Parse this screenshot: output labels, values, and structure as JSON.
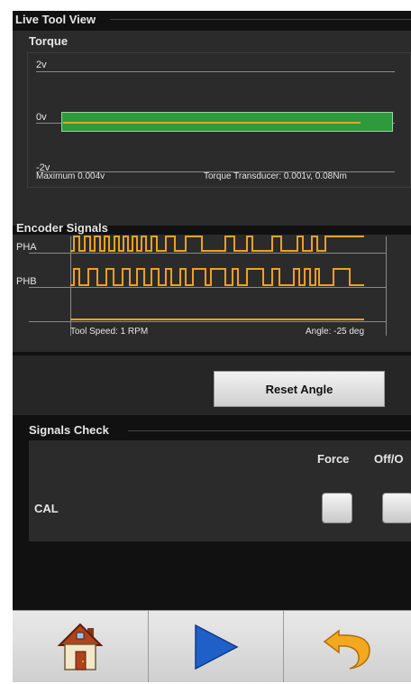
{
  "window": {
    "title": "Live Tool View"
  },
  "torque": {
    "title": "Torque",
    "axis_top": "2v",
    "axis_mid": "0v",
    "axis_bottom": "-2v",
    "max_label": "Maximum 0.004v",
    "transducer_label": "Torque Transducer: 0.001v,  0.08Nm",
    "level_colors": {
      "fill": "#2e9a3c",
      "line": "#f0a020"
    }
  },
  "encoder": {
    "title": "Encoder Signals",
    "pha_label": "PHA",
    "phb_label": "PHB",
    "speed_label": "Tool Speed: 1 RPM",
    "angle_label": "Angle:  -25 deg",
    "signal_color": "#f0a020"
  },
  "reset": {
    "label": "Reset Angle"
  },
  "signals_check": {
    "title": "Signals Check",
    "col_force": "Force",
    "col_offon": "Off/O",
    "row_label": "CAL"
  },
  "toolbar": {
    "home_icon": "home-icon",
    "play_icon": "play-icon",
    "back_icon": "undo-icon"
  }
}
